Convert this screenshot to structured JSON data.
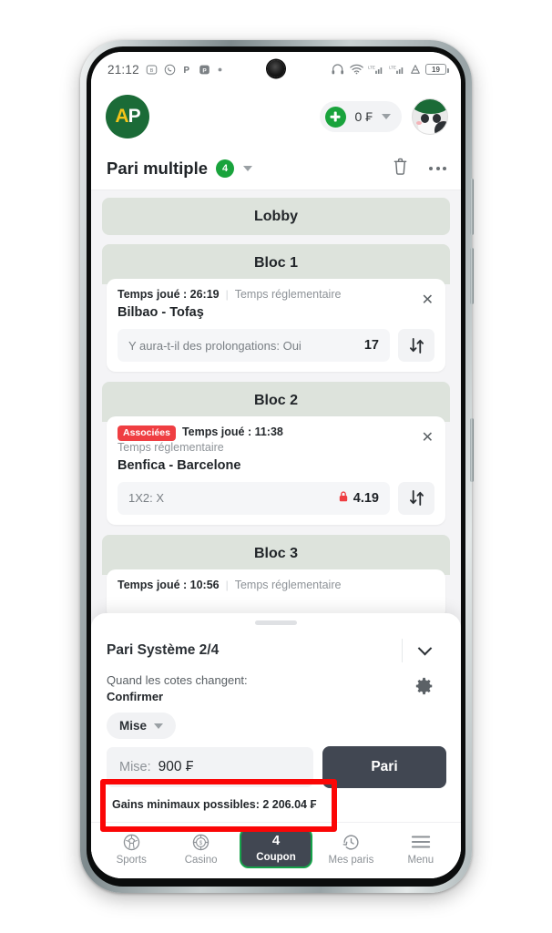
{
  "status_bar": {
    "clock": "21:12",
    "left_icons": [
      "bubble-b-icon",
      "whatsapp-icon",
      "p-icon",
      "powerpoint-icon",
      "dot-icon"
    ],
    "right_icons": [
      "headphones-icon",
      "wifi-icon",
      "lte-signal-icon",
      "lte-signal-2-icon",
      "alarm-icon"
    ],
    "battery_level": "19"
  },
  "header": {
    "logo_a": "A",
    "logo_p": "P",
    "balance": "0 ₣",
    "plus_icon": "plus-circle-icon",
    "balance_caret": "chevron-down-icon",
    "avatar_icon": "avatar-panda-icon"
  },
  "coupon_bar": {
    "title": "Pari multiple",
    "count": "4",
    "caret_icon": "chevron-down-icon",
    "trash_icon": "trash-icon",
    "more_icon": "more-horizontal-icon"
  },
  "blocks": [
    {
      "head": "Lobby",
      "bets": []
    },
    {
      "head": "Bloc 1",
      "bets": [
        {
          "badge": "",
          "played": "Temps joué : 26:19",
          "separator": "|",
          "regulation": "Temps réglementaire",
          "regulation_block": false,
          "teams": "Bilbao - Tofaş",
          "selection": "Y aura-t-il des prolongations: Oui",
          "locked": false,
          "odd": "17",
          "close_icon": "close-icon",
          "swap_icon": "swap-arrows-icon"
        }
      ]
    },
    {
      "head": "Bloc 2",
      "bets": [
        {
          "badge": "Associées",
          "played": "Temps joué : 11:38",
          "separator": "",
          "regulation": "Temps réglementaire",
          "regulation_block": true,
          "teams": "Benfica - Barcelone",
          "selection": "1X2: X",
          "locked": true,
          "lock_icon": "lock-icon",
          "odd": "4.19",
          "close_icon": "close-icon",
          "swap_icon": "swap-arrows-icon"
        }
      ]
    },
    {
      "head": "Bloc 3",
      "bets": [
        {
          "badge": "",
          "played": "Temps joué : 10:56",
          "separator": "|",
          "regulation": "Temps réglementaire",
          "regulation_block": false,
          "teams": "",
          "selection": "",
          "locked": false,
          "odd": "",
          "close_icon": "close-icon",
          "swap_icon": "swap-arrows-icon"
        }
      ]
    }
  ],
  "sheet": {
    "system_label": "Pari Système 2/4",
    "collapse_icon": "chevron-down-icon",
    "odds_change_label": "Quand les cotes changent:",
    "odds_change_value": "Confirmer",
    "gear_icon": "gear-icon",
    "mise_dropdown_label": "Mise",
    "mise_dropdown_icon": "caret-down-icon",
    "stake_prefix": "Mise:",
    "stake_value": "900 ₣",
    "bet_button_label": "Pari",
    "min_gain": "Gains minimaux possibles: 2 206.04 ₣"
  },
  "bottom_nav": [
    {
      "label": "Sports",
      "icon": "soccer-ball-icon",
      "badge": "",
      "active": false
    },
    {
      "label": "Casino",
      "icon": "casino-chip-icon",
      "badge": "",
      "active": false
    },
    {
      "label": "Coupon",
      "icon": "",
      "badge": "4",
      "active": true
    },
    {
      "label": "Mes paris",
      "icon": "history-clock-icon",
      "badge": "",
      "active": false
    },
    {
      "label": "Menu",
      "icon": "hamburger-menu-icon",
      "badge": "",
      "active": false
    }
  ],
  "annotations": {
    "highlight_box": "red-rectangle-highlight",
    "arrow": "red-down-arrow"
  },
  "colors": {
    "brand_green": "#1b6b37",
    "accent_green": "#19a33c",
    "annotation_red": "#fb0606",
    "badge_red": "#ef3e42",
    "dark_button": "#414752",
    "block_header": "#dde3dc"
  }
}
